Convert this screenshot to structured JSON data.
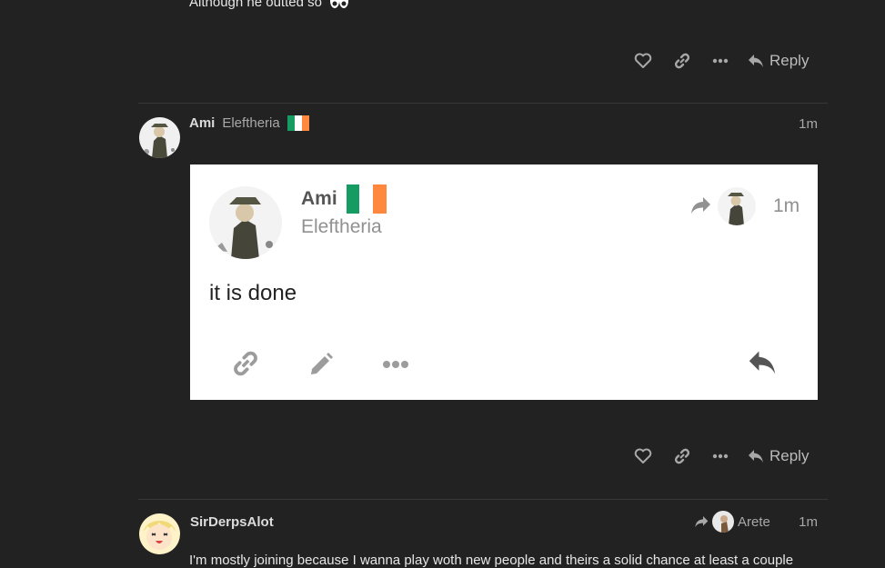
{
  "previous_post": {
    "text": "Although he outted so",
    "emoji": "eyes-emoji"
  },
  "actions": {
    "reply_label": "Reply"
  },
  "post_ami": {
    "username": "Ami",
    "user_title": "Eleftheria",
    "time": "1m",
    "flag_colors": [
      "#169b62",
      "#ffffff",
      "#ff883e"
    ]
  },
  "embedded_card": {
    "username": "Ami",
    "user_title": "Eleftheria",
    "time": "1m",
    "body": "it is done"
  },
  "post_sir": {
    "username": "SirDerpsAlot",
    "reply_to": "Arete",
    "time": "1m",
    "body": "I'm mostly joining because I wanna play woth new people and theirs a solid chance at least a couple"
  },
  "colors": {
    "background": "#222222",
    "card": "#ffffff",
    "muted": "#a8a8a8"
  }
}
